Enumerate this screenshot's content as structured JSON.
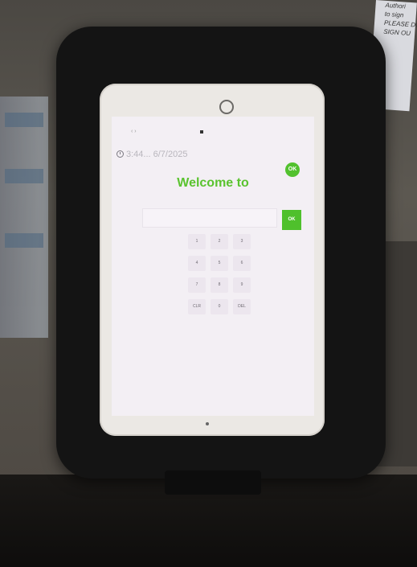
{
  "sign": {
    "lines": [
      "Authori",
      "to sign",
      "PLEASE DO",
      "SIGN OU"
    ]
  },
  "device": {
    "statusbar": {
      "left": "",
      "right": ""
    },
    "browser": {
      "nav_icons": "‹ ›",
      "url": "",
      "tool_icons": ""
    }
  },
  "app": {
    "clock_text": "3:44... 6/7/2025",
    "logo_mark": "OK",
    "logo_word": "",
    "welcome": "Welcome to",
    "subtitle": "",
    "input_placeholder": "",
    "ok_label": "OK",
    "keypad": [
      "1",
      "2",
      "3",
      "4",
      "5",
      "6",
      "7",
      "8",
      "9",
      "CLR",
      "0",
      "DEL"
    ],
    "brand_color": "#52c12e"
  },
  "icons": [
    "clock-icon",
    "lock-icon",
    "logo-mark-icon"
  ]
}
